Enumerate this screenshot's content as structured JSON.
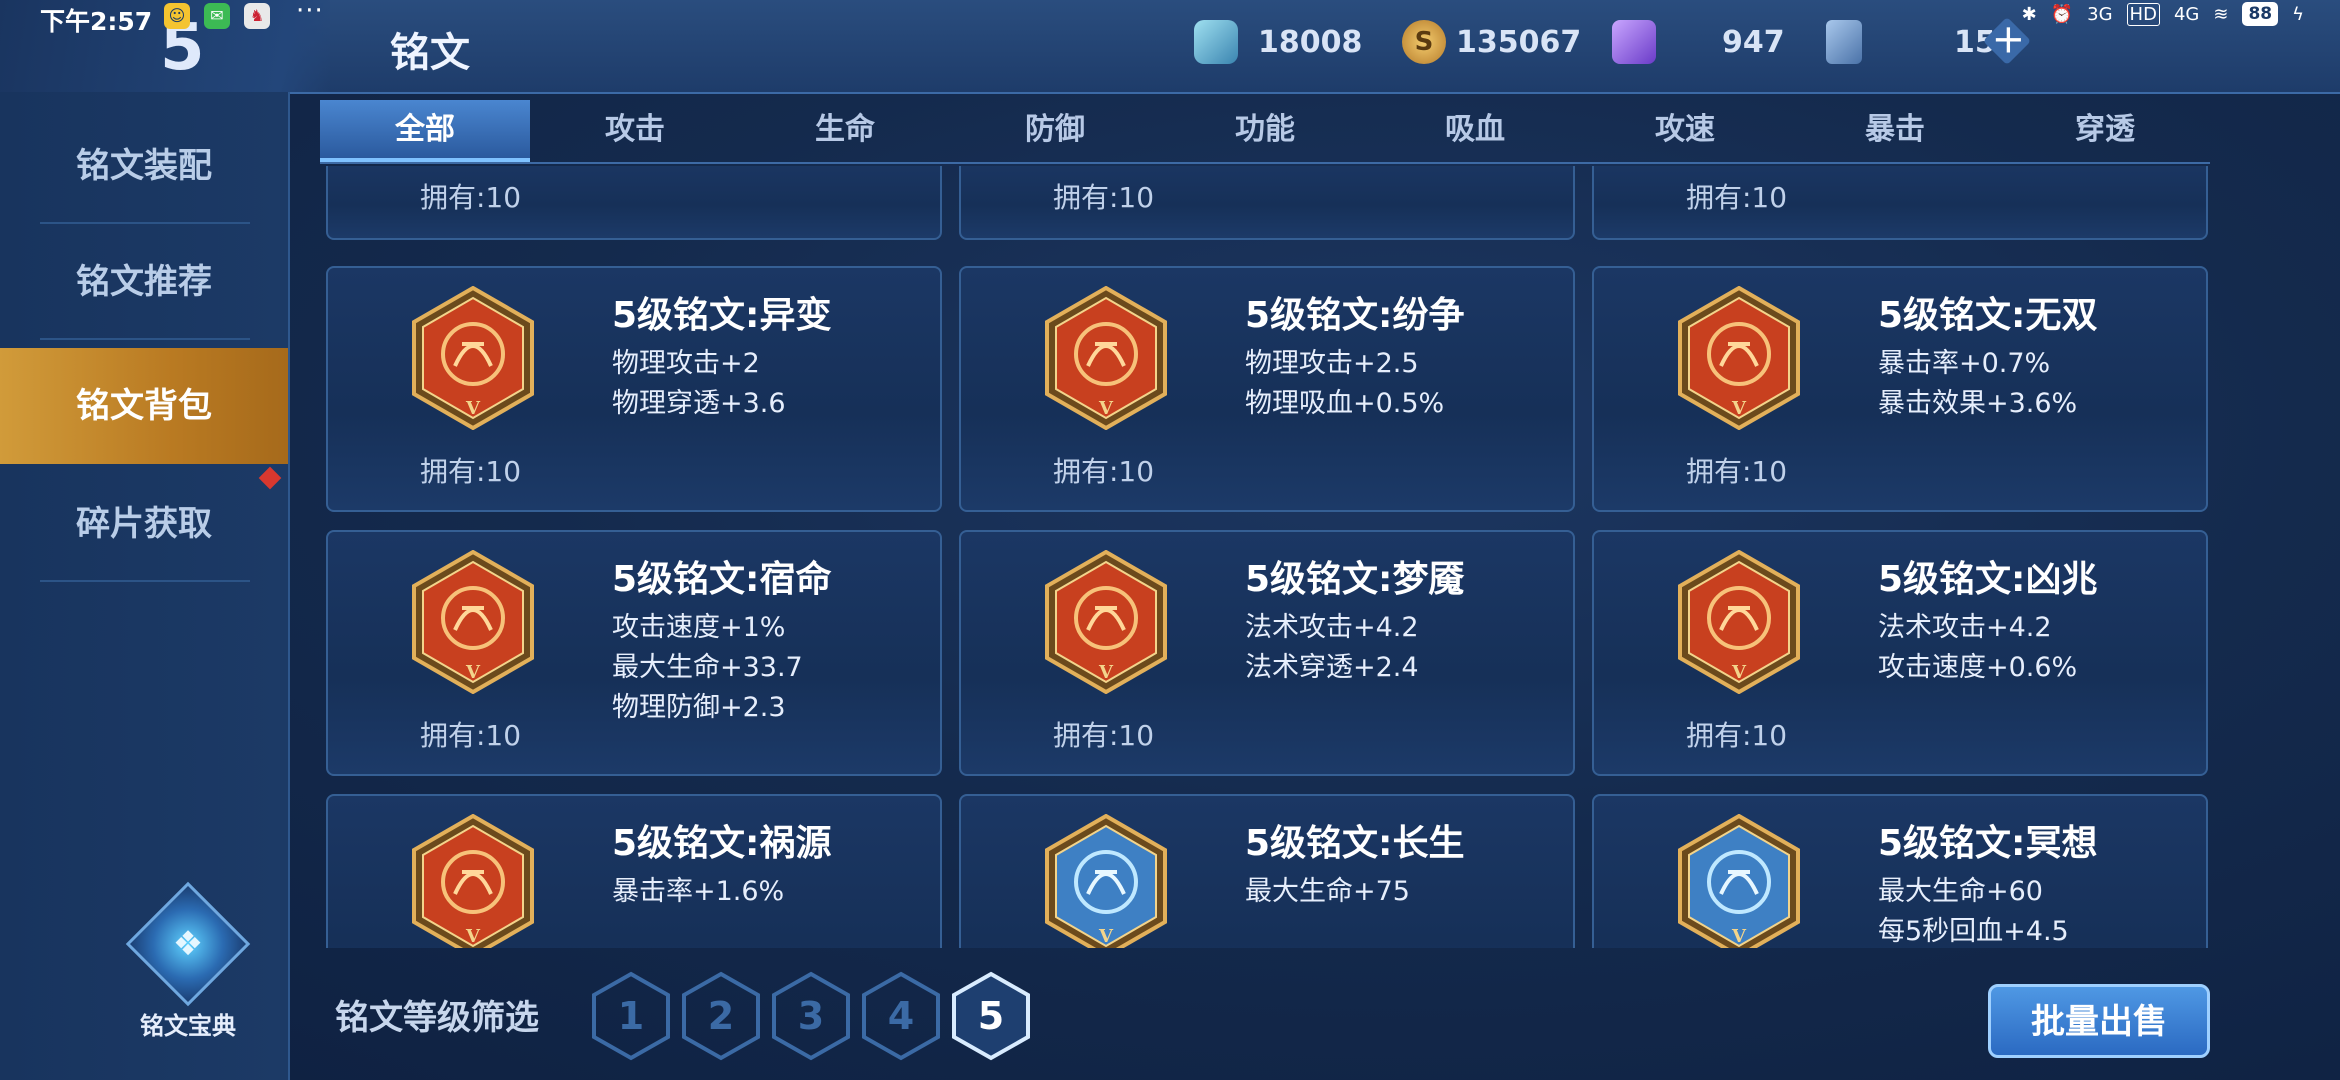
{
  "status_bar": {
    "time": "下午2:57",
    "more": "···",
    "net_labels": [
      "3G",
      "HD",
      "4G"
    ],
    "battery": "88"
  },
  "header": {
    "title": "铭文",
    "currencies": [
      {
        "icon": "crystal-icon",
        "value": "18008"
      },
      {
        "icon": "gold-coin-icon",
        "value": "135067"
      },
      {
        "icon": "gem-icon",
        "value": "947"
      },
      {
        "icon": "card-icon",
        "value": "15"
      }
    ],
    "plus": "+"
  },
  "sidebar": {
    "items": [
      {
        "label": "铭文装配",
        "active": false
      },
      {
        "label": "铭文推荐",
        "active": false
      },
      {
        "label": "铭文背包",
        "active": true
      },
      {
        "label": "碎片获取",
        "active": false
      }
    ],
    "codex_label": "铭文宝典"
  },
  "tabs": [
    "全部",
    "攻击",
    "生命",
    "防御",
    "功能",
    "吸血",
    "攻速",
    "暴击",
    "穿透"
  ],
  "active_tab": "全部",
  "partial_row": [
    {
      "owned": "拥有:10"
    },
    {
      "owned": "拥有:10"
    },
    {
      "owned": "拥有:10"
    }
  ],
  "runes": [
    {
      "title": "5级铭文:异变",
      "stats": [
        "物理攻击+2",
        "物理穿透+3.6"
      ],
      "owned": "拥有:10",
      "color": "red",
      "icon": "rune-yibian-icon"
    },
    {
      "title": "5级铭文:纷争",
      "stats": [
        "物理攻击+2.5",
        "物理吸血+0.5%"
      ],
      "owned": "拥有:10",
      "color": "red",
      "icon": "rune-fenzheng-icon"
    },
    {
      "title": "5级铭文:无双",
      "stats": [
        "暴击率+0.7%",
        "暴击效果+3.6%"
      ],
      "owned": "拥有:10",
      "color": "red",
      "icon": "rune-wushuang-icon"
    },
    {
      "title": "5级铭文:宿命",
      "stats": [
        "攻击速度+1%",
        "最大生命+33.7",
        "物理防御+2.3"
      ],
      "owned": "拥有:10",
      "color": "red",
      "icon": "rune-suming-icon"
    },
    {
      "title": "5级铭文:梦魇",
      "stats": [
        "法术攻击+4.2",
        "法术穿透+2.4"
      ],
      "owned": "拥有:10",
      "color": "red",
      "icon": "rune-mengyan-icon"
    },
    {
      "title": "5级铭文:凶兆",
      "stats": [
        "法术攻击+4.2",
        "攻击速度+0.6%"
      ],
      "owned": "拥有:10",
      "color": "red",
      "icon": "rune-xiongzhao-icon"
    },
    {
      "title": "5级铭文:祸源",
      "stats": [
        "暴击率+1.6%"
      ],
      "owned": "",
      "color": "red",
      "icon": "rune-huoyuan-icon"
    },
    {
      "title": "5级铭文:长生",
      "stats": [
        "最大生命+75"
      ],
      "owned": "",
      "color": "blue",
      "icon": "rune-changsheng-icon"
    },
    {
      "title": "5级铭文:冥想",
      "stats": [
        "最大生命+60",
        "每5秒回血+4.5"
      ],
      "owned": "",
      "color": "blue",
      "icon": "rune-mingxiang-icon"
    }
  ],
  "rune_level_mark": "V",
  "footer": {
    "filter_label": "铭文等级筛选",
    "levels": [
      "1",
      "2",
      "3",
      "4",
      "5"
    ],
    "active_level": "5",
    "sell_label": "批量出售"
  },
  "colors": {
    "red_rune": "#c8401f",
    "blue_rune": "#3e80c4",
    "gold_frame": "#e2b05a",
    "accent": "#3b86d8"
  }
}
